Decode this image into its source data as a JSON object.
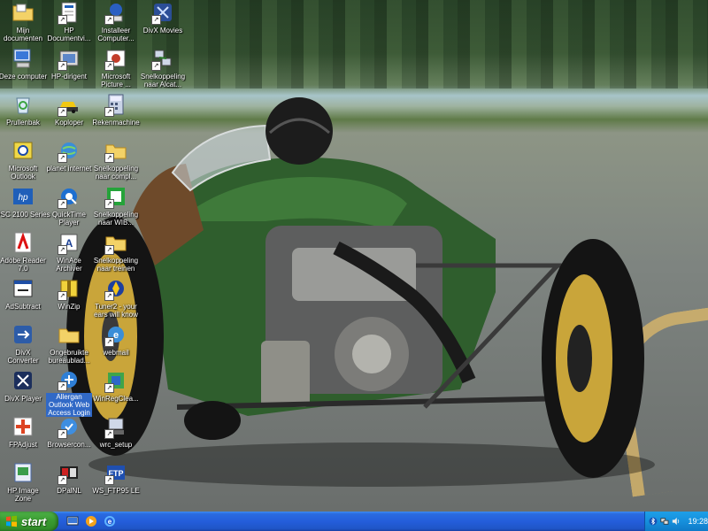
{
  "desktop": {
    "icons": [
      {
        "label": "Mijn\ndocumenten",
        "icon": "folder-documents-icon"
      },
      {
        "label": "HP\nDocumentvi...",
        "icon": "document-viewer-icon"
      },
      {
        "label": "Installeer\nComputer...",
        "icon": "installer-icon"
      },
      {
        "label": "DivX Movies",
        "icon": "divx-movies-icon"
      },
      {
        "label": "Deze computer",
        "icon": "my-computer-icon"
      },
      {
        "label": "HP-dirigent",
        "icon": "hp-director-icon"
      },
      {
        "label": "Microsoft\nPicture ...",
        "icon": "picture-it-icon"
      },
      {
        "label": "Snelkoppeling\nnaar Alcat...",
        "icon": "network-shortcut-icon"
      },
      {
        "label": "Prullenbak",
        "icon": "recycle-bin-icon"
      },
      {
        "label": "Koploper",
        "icon": "koploper-icon"
      },
      {
        "label": "Rekenmachine",
        "icon": "calculator-icon"
      },
      {
        "label": "Microsoft\nOutlook",
        "icon": "outlook-icon"
      },
      {
        "label": "planet internet",
        "icon": "planet-internet-icon"
      },
      {
        "label": "Snelkoppeling\nnaar compl...",
        "icon": "folder-shortcut-icon"
      },
      {
        "label": "PSC 2100 Series",
        "icon": "hp-printer-icon"
      },
      {
        "label": "QuickTime\nPlayer",
        "icon": "quicktime-icon"
      },
      {
        "label": "Snelkoppeling\nnaar WIB...",
        "icon": "green-shortcut-icon"
      },
      {
        "label": "Adobe Reader\n7.0",
        "icon": "adobe-reader-icon"
      },
      {
        "label": "WinAce\nArchiver",
        "icon": "winace-icon"
      },
      {
        "label": "Snelkoppeling\nnaar treinen",
        "icon": "folder-trains-icon"
      },
      {
        "label": "AdSubtract",
        "icon": "adsubtract-icon"
      },
      {
        "label": "WinZip",
        "icon": "winzip-icon"
      },
      {
        "label": "Tuner2 - your\nears will know",
        "icon": "tuner-icon"
      },
      {
        "label": "DivX\nConverter",
        "icon": "divx-converter-icon"
      },
      {
        "label": "Ongebruikte\nbureaublad...",
        "icon": "unused-desktop-folder-icon"
      },
      {
        "label": "webmail",
        "icon": "webmail-icon"
      },
      {
        "label": "DivX Player",
        "icon": "divx-player-icon"
      },
      {
        "label": "Allergan\nOutlook Web\nAccess Login",
        "icon": "owa-login-icon"
      },
      {
        "label": "WinRegClea...",
        "icon": "winregclean-icon"
      },
      {
        "label": "FPAdjust",
        "icon": "fpadjust-icon"
      },
      {
        "label": "Browsercon...",
        "icon": "browser-config-icon"
      },
      {
        "label": "wrc_setup",
        "icon": "wrc-setup-icon"
      },
      {
        "label": "HP Image\nZone",
        "icon": "hp-image-zone-icon"
      },
      {
        "label": "DPalNL",
        "icon": "dpal-icon"
      },
      {
        "label": "WS_FTP95 LE",
        "icon": "ws-ftp-icon"
      }
    ]
  },
  "taskbar": {
    "start_label": "start",
    "quick_launch": [
      "show-desktop-icon",
      "media-player-icon",
      "internet-explorer-icon"
    ],
    "tray_icons": [
      "bluetooth-icon",
      "network-icon",
      "volume-icon"
    ],
    "clock": "19:28"
  },
  "colors": {
    "taskbar_blue": "#245edb",
    "start_green": "#3a9b31",
    "tray_blue": "#1690dc",
    "selection_blue": "#3169c6"
  }
}
